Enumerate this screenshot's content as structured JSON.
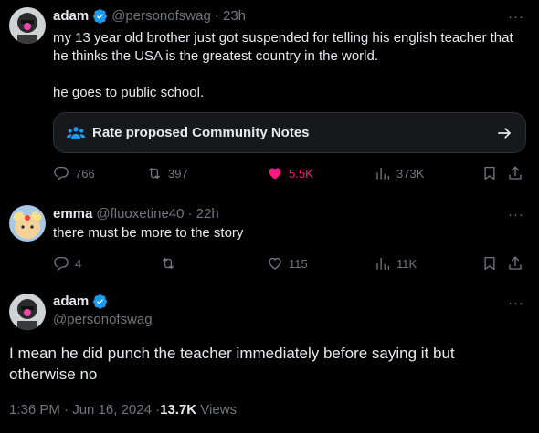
{
  "tweet1": {
    "name": "adam",
    "handle": "@personofswag",
    "time": "· 23h",
    "more": "···",
    "text_line1": "my 13 year old brother just got suspended for telling his english teacher that",
    "text_line2": "he thinks the USA is the greatest country in the world.",
    "text_line3": "he goes to public school.",
    "community_notes": "Rate proposed Community Notes",
    "replies": "766",
    "reposts": "397",
    "likes": "5.5K",
    "views": "373K"
  },
  "tweet2": {
    "name": "emma",
    "handle": "@fluoxetine40",
    "time": "· 22h",
    "more": "···",
    "text": "there must be more to the story",
    "replies": "4",
    "likes": "115",
    "views": "11K"
  },
  "tweet3": {
    "name": "adam",
    "handle": "@personofswag",
    "more": "···",
    "text_line1": "I mean he did punch the teacher immediately before saying it but",
    "text_line2": "otherwise no",
    "timestamp": "1:36 PM · Jun 16, 2024 · ",
    "views_count": "13.7K",
    "views_label": " Views"
  },
  "colors": {
    "background": "#000000",
    "text": "#e7e9ea",
    "muted": "#71767b",
    "verified": "#1d9bf0",
    "like": "#f91880"
  },
  "icons": [
    "verified-badge-icon",
    "community-notes-icon",
    "arrow-right-icon",
    "reply-icon",
    "repost-icon",
    "heart-icon",
    "views-icon",
    "bookmark-icon",
    "share-icon"
  ]
}
